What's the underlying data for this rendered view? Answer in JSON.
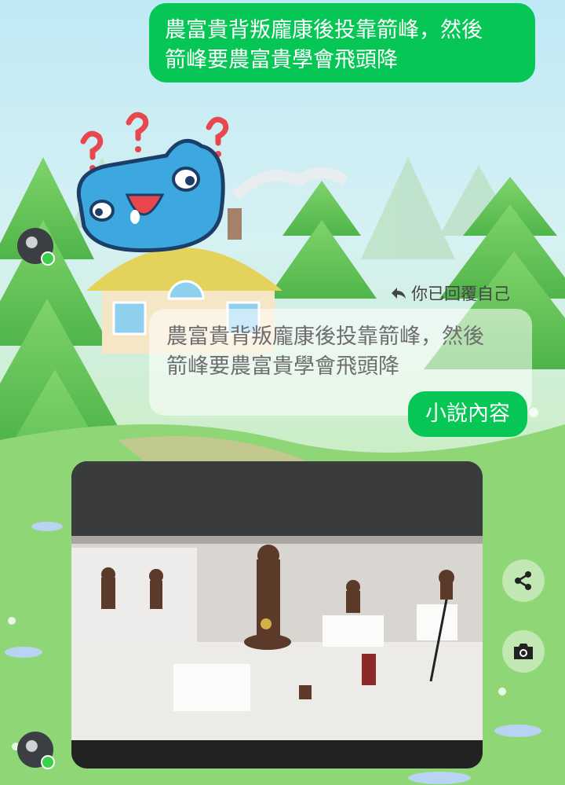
{
  "messages": {
    "outgoing_1": {
      "line1": "農富貴背叛龐康後投靠箭峰，然後",
      "line2": "箭峰要農富貴學會飛頭降"
    },
    "reply_label": "你已回覆自己",
    "quoted": {
      "line1": "農富貴背叛龐康後投靠箭峰，然後",
      "line2": "箭峰要農富貴學會飛頭降"
    },
    "outgoing_2": "小說內容"
  },
  "sticker": {
    "icon": "confused-blue-cat-sticker"
  },
  "photo": {
    "description_icon": "museum-display-case-photo"
  },
  "actions": {
    "share_icon": "share-icon",
    "camera_icon": "camera-icon"
  },
  "colors": {
    "bubble_green": "#06c755"
  }
}
